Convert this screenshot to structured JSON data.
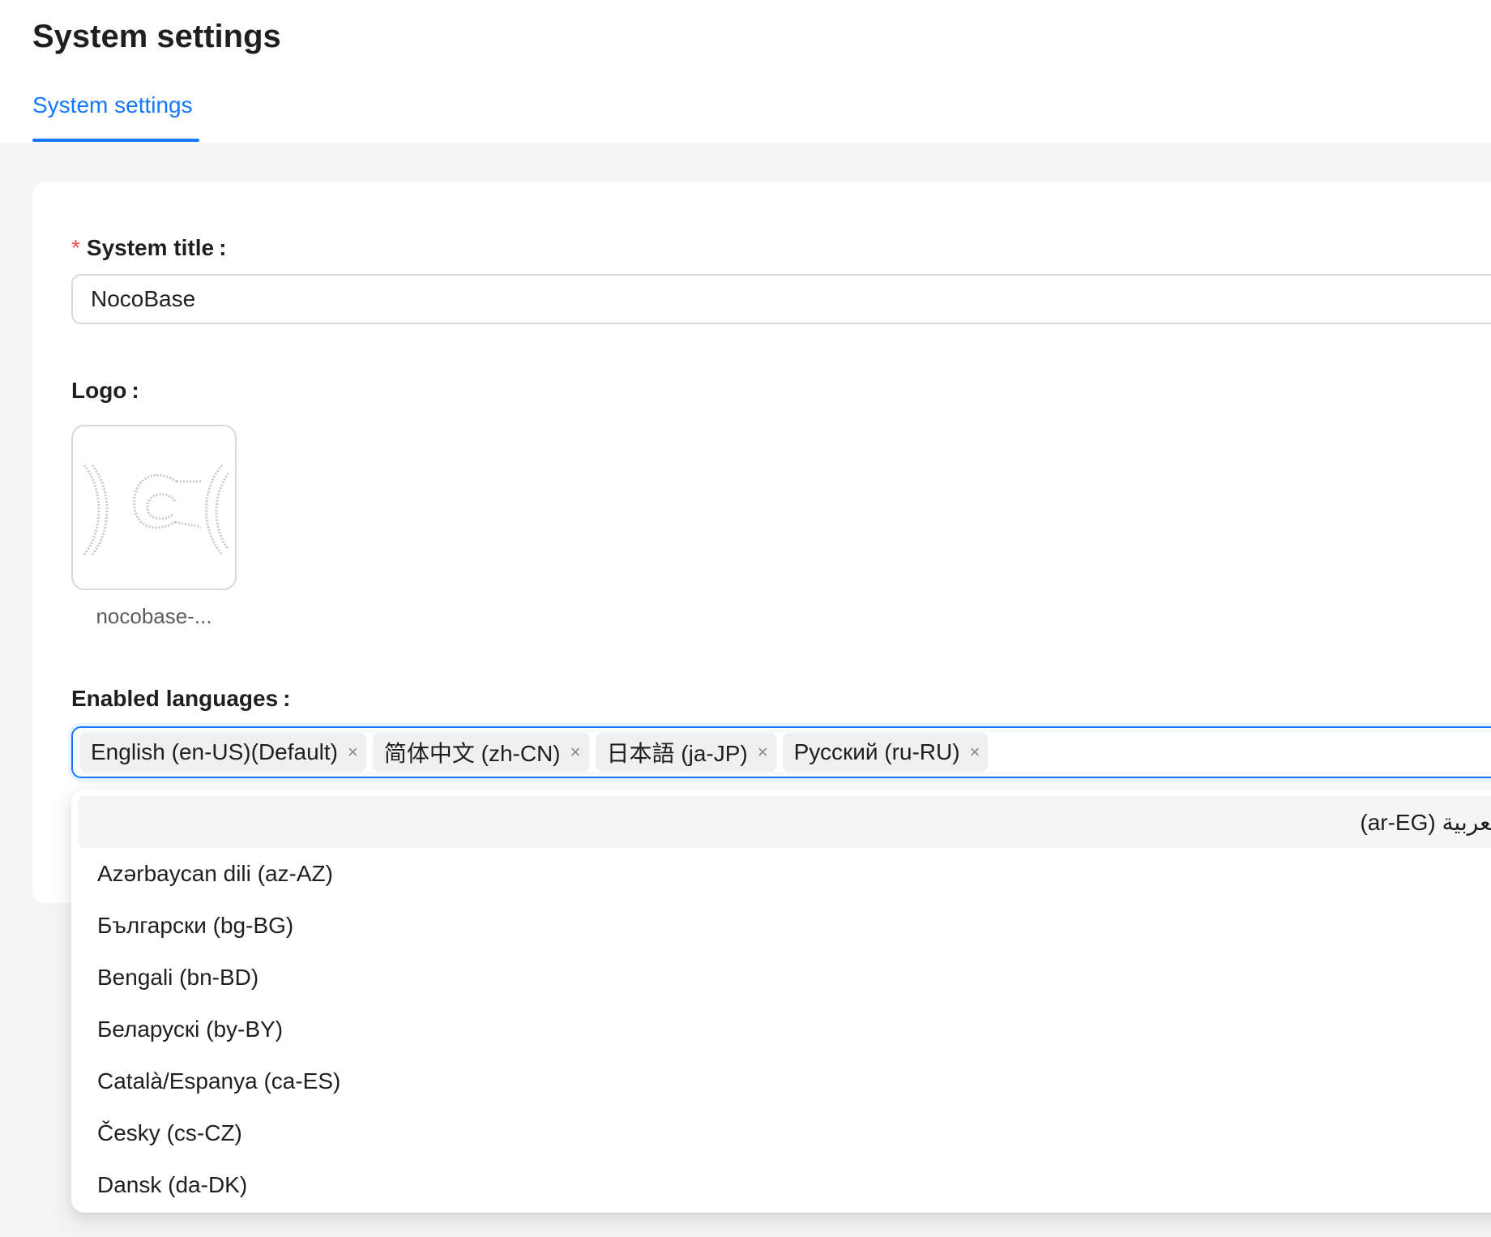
{
  "header": {
    "title": "System settings",
    "tabs": [
      {
        "label": "System settings",
        "active": true
      }
    ]
  },
  "form": {
    "system_title": {
      "required": "*",
      "label": "System title",
      "colon": ":",
      "value": "NocoBase"
    },
    "logo": {
      "label": "Logo",
      "colon": ":",
      "filename": "nocobase-..."
    },
    "enabled_languages": {
      "label": "Enabled languages",
      "colon": ":",
      "selected": [
        {
          "label": "English (en-US)(Default)"
        },
        {
          "label": "简体中文 (zh-CN)"
        },
        {
          "label": "日本語 (ja-JP)"
        },
        {
          "label": "Русский (ru-RU)"
        }
      ],
      "remove_icon": "×",
      "options": [
        {
          "label": "العربية (ar-EG)",
          "active": true
        },
        {
          "label": "Azərbaycan dili (az-AZ)"
        },
        {
          "label": "Български (bg-BG)"
        },
        {
          "label": "Bengali (bn-BD)"
        },
        {
          "label": "Беларускі (by-BY)"
        },
        {
          "label": "Català/Espanya (ca-ES)"
        },
        {
          "label": "Česky (cs-CZ)"
        },
        {
          "label": "Dansk (da-DK)"
        }
      ]
    }
  },
  "colors": {
    "primary": "#1677ff",
    "required": "#ff4d4f",
    "page_bg": "#f5f5f5"
  }
}
